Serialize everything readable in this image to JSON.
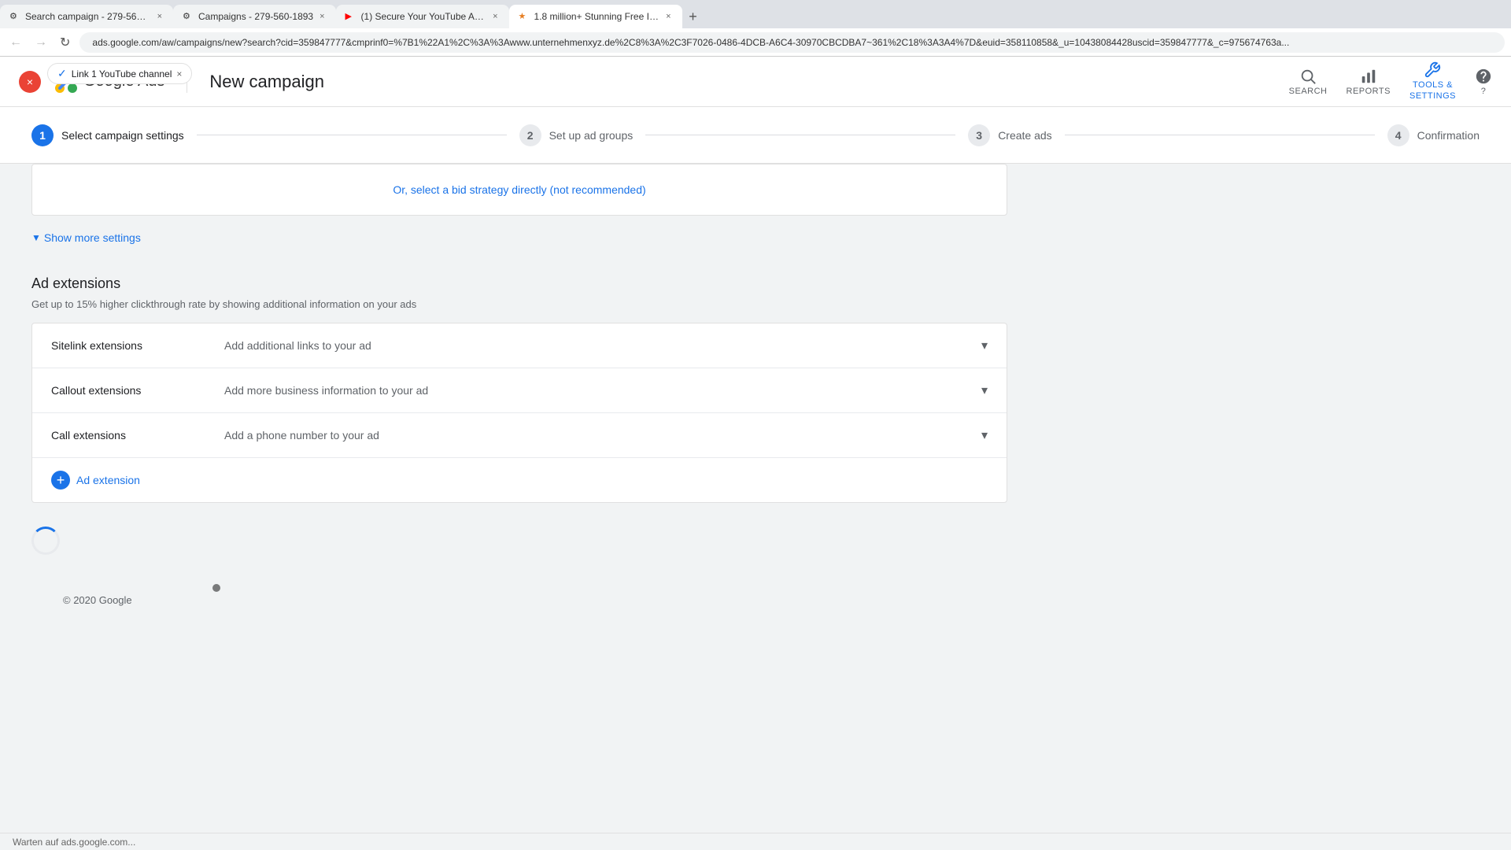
{
  "browser": {
    "tabs": [
      {
        "id": "tab1",
        "label": "Search campaign - 279-560-...",
        "active": false,
        "favicon": "⚙"
      },
      {
        "id": "tab2",
        "label": "Campaigns - 279-560-1893",
        "active": false,
        "favicon": "⚙"
      },
      {
        "id": "tab3",
        "label": "(1) Secure Your YouTube Acco...",
        "active": false,
        "favicon": "▶"
      },
      {
        "id": "tab4",
        "label": "1.8 million+ Stunning Free Im...",
        "active": true,
        "favicon": "★"
      }
    ],
    "address": "ads.google.com/aw/campaigns/new?search?cid=359847777&cmprinf0=%7B1%22A1%2C%3A%3Awww.unternehmenxyz.de%2C8%3A%2C3F7026-0486-4DCB-A6C4-30970CBCDBA7~361%2C18%3A3A4%7D&euid=358110858&_u=10438084428uscid=359847777&_c=975674763a...",
    "nav_back": "←",
    "nav_forward": "→",
    "nav_refresh": "↻"
  },
  "header": {
    "close_label": "×",
    "brand": "Google Ads",
    "separator": "|",
    "page_title": "New campaign",
    "notification": {
      "text": "Link 1 YouTube channel",
      "close": "×"
    },
    "nav_items": [
      {
        "id": "search",
        "label": "SEARCH"
      },
      {
        "id": "reports",
        "label": "REPORTS"
      },
      {
        "id": "tools",
        "label": "TOOLS & SETTINGS"
      },
      {
        "id": "help",
        "label": "?"
      }
    ]
  },
  "stepper": {
    "steps": [
      {
        "number": "1",
        "label": "Select campaign settings",
        "active": true
      },
      {
        "number": "2",
        "label": "Set up ad groups",
        "active": false
      },
      {
        "number": "3",
        "label": "Create ads",
        "active": false
      },
      {
        "number": "4",
        "label": "Confirmation",
        "active": false
      }
    ]
  },
  "bid_direct": {
    "link_text": "Or, select a bid strategy directly (not recommended)"
  },
  "show_more": {
    "label": "Show more settings"
  },
  "ad_extensions": {
    "title": "Ad extensions",
    "description": "Get up to 15% higher clickthrough rate by showing additional information on your ads",
    "extensions": [
      {
        "name": "Sitelink extensions",
        "description": "Add additional links to your ad"
      },
      {
        "name": "Callout extensions",
        "description": "Add more business information to your ad"
      },
      {
        "name": "Call extensions",
        "description": "Add a phone number to your ad"
      }
    ],
    "add_label": "Ad extension"
  },
  "footer": {
    "copyright": "© 2020 Google"
  },
  "status_bar": {
    "text": "Warten auf ads.google.com..."
  }
}
